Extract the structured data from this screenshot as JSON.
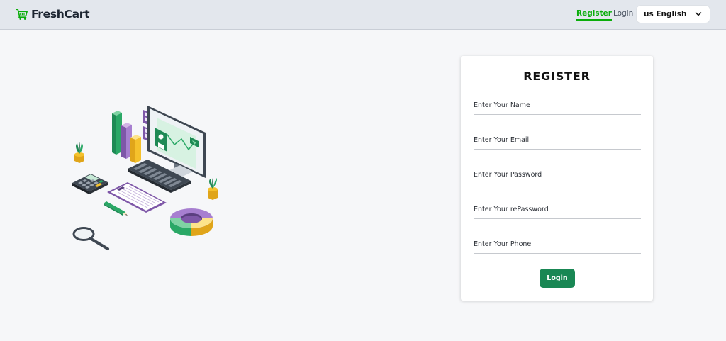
{
  "navbar": {
    "brand_name": "FreshCart",
    "brand_icon": "cart-icon",
    "links": {
      "register": "Register",
      "login": "Login"
    },
    "language": {
      "selected": "us English",
      "icon": "chevron-down-icon"
    }
  },
  "illustration": {
    "icon": "analytics-workspace-illustration"
  },
  "register_form": {
    "title": "REGISTER",
    "fields": {
      "name_placeholder": "Enter Your Name",
      "email_placeholder": "Enter Your Email",
      "password_placeholder": "Enter Your Password",
      "repassword_placeholder": "Enter Your rePassword",
      "phone_placeholder": "Enter Your Phone"
    },
    "submit_label": "Login"
  },
  "colors": {
    "brand_green": "#0aad0a",
    "button_green": "#198754",
    "navbar_bg": "#e3e7ed",
    "page_bg": "#f6f7f9"
  }
}
